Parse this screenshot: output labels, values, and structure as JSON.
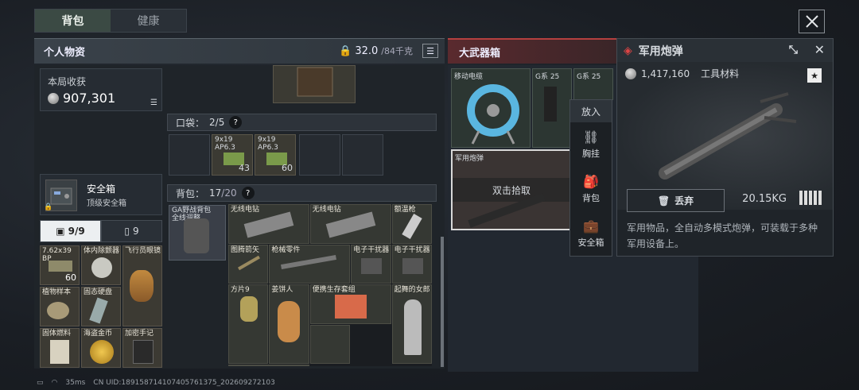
{
  "tabs": [
    "背包",
    "健康"
  ],
  "personal": {
    "title": "个人物资",
    "weight": "32.0",
    "weight_max": "/84千克"
  },
  "earnings": {
    "label": "本局收获",
    "value": "907,301"
  },
  "safe_box": {
    "title": "安全箱",
    "subtitle": "顶级安全箱"
  },
  "filters": [
    {
      "count": "9/9"
    },
    {
      "count": "9"
    }
  ],
  "left_items": [
    {
      "name": "7.62x39 BP",
      "count": "60"
    },
    {
      "name": "体内除颤器",
      "count": ""
    },
    {
      "name": "飞行员眼镜",
      "count": ""
    },
    {
      "name": "植物样本",
      "count": ""
    },
    {
      "name": "固态硬盘",
      "count": ""
    },
    {
      "name": "",
      "count": ""
    },
    {
      "name": "固体燃料",
      "count": ""
    },
    {
      "name": "海盗金币",
      "count": ""
    },
    {
      "name": "加密手记",
      "count": ""
    }
  ],
  "pocket": {
    "label": "口袋：",
    "count": "2/5",
    "help": "?",
    "items": [
      {
        "name": "9x19 AP6.3",
        "count": "43"
      },
      {
        "name": "9x19 AP6.3",
        "count": "60"
      }
    ]
  },
  "backpack": {
    "label": "背包：",
    "count": "17",
    "max": "/20",
    "help": "?",
    "bag_name": "GA野战背包 全线调整"
  },
  "bp_items": [
    {
      "name": "无线电钻"
    },
    {
      "name": "无线电钻"
    },
    {
      "name": "额温枪"
    },
    {
      "name": "图腾箭矢"
    },
    {
      "name": "枪械零件"
    },
    {
      "name": "电子干扰器"
    },
    {
      "name": "电子干扰器"
    },
    {
      "name": "方片9"
    },
    {
      "name": "姜饼人"
    },
    {
      "name": "便携生存套组"
    },
    {
      "name": "起舞的女郎"
    }
  ],
  "weapons": {
    "title": "大武器箱",
    "cells": [
      "移动电缆",
      "G系 25",
      "G系 25",
      "军用炮弹"
    ],
    "pickup": "双击拾取"
  },
  "put_menu": {
    "title": "放入",
    "options": [
      "胸挂",
      "背包",
      "安全箱"
    ]
  },
  "detail": {
    "title": "军用炮弹",
    "price": "1,417,160",
    "category": "工具材料",
    "weight": "20.15KG",
    "discard": "丢弃",
    "desc": "军用物品，全自动多模式炮弹，可装载于多种军用设备上。"
  },
  "status": {
    "ping": "35ms",
    "uid": "CN UID:18915871410740576137​5_202609272103"
  },
  "colors": {
    "accent_red": "#b4403f",
    "panel": "#262c33"
  }
}
